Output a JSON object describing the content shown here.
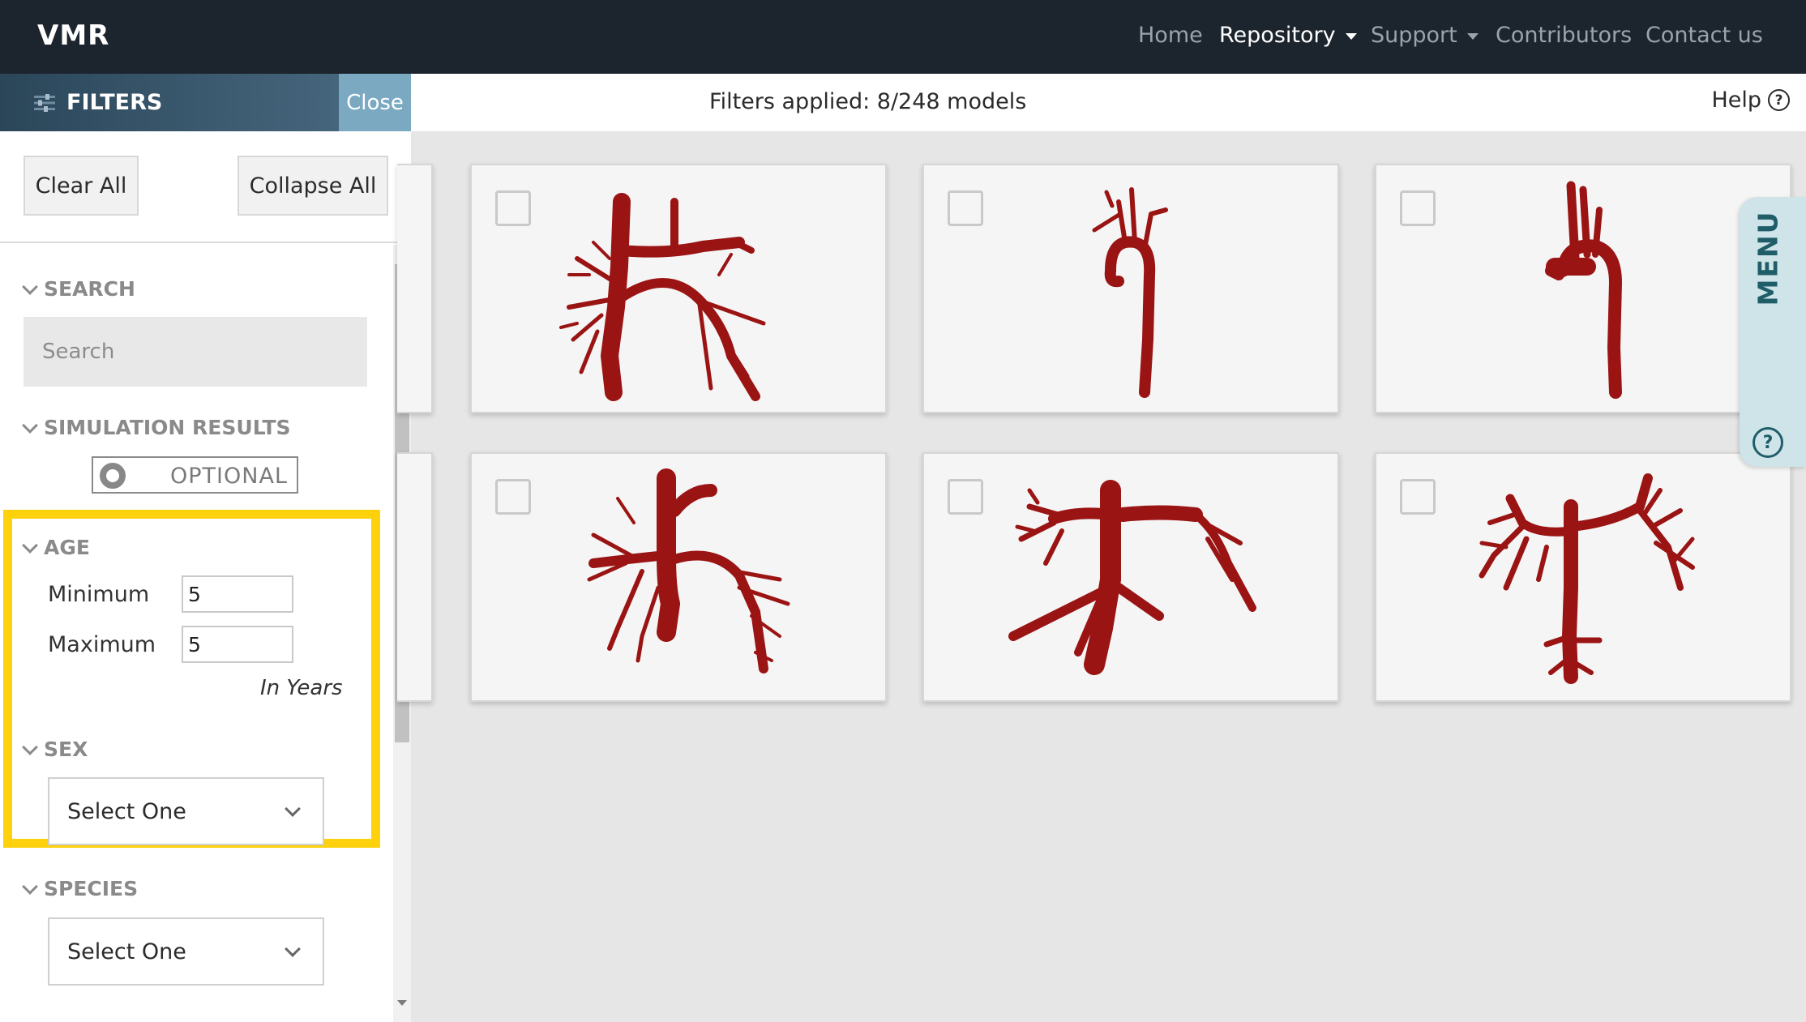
{
  "navbar": {
    "brand": "VMR",
    "items": [
      {
        "label": "Home",
        "active": false,
        "dropdown": false
      },
      {
        "label": "Repository",
        "active": true,
        "dropdown": true
      },
      {
        "label": "Support",
        "active": false,
        "dropdown": true
      },
      {
        "label": "Contributors",
        "active": false,
        "dropdown": false
      },
      {
        "label": "Contact us",
        "active": false,
        "dropdown": false
      }
    ]
  },
  "filters": {
    "title": "FILTERS",
    "close_label": "Close",
    "clear_all_label": "Clear All",
    "collapse_all_label": "Collapse All",
    "search": {
      "heading": "SEARCH",
      "placeholder": "Search",
      "value": ""
    },
    "simulation_results": {
      "heading": "SIMULATION RESULTS",
      "toggle_label": "OPTIONAL"
    },
    "age": {
      "heading": "AGE",
      "min_label": "Minimum",
      "min_value": "5",
      "max_label": "Maximum",
      "max_value": "5",
      "unit": "In Years",
      "highlight_color": "#fdd10c"
    },
    "sex": {
      "heading": "SEX",
      "selected": "Select One"
    },
    "species": {
      "heading": "SPECIES",
      "selected": "Select One"
    }
  },
  "status": {
    "text": "Filters applied: 8/248 models",
    "help_label": "Help",
    "help_icon": "question-circle-icon"
  },
  "menu_tab": {
    "label": "MENU",
    "help_icon": "question-circle-icon"
  },
  "models": {
    "count_visible": 6,
    "vessel_color": "#9b1414",
    "cards": [
      {
        "kind": "pulmonary-tree"
      },
      {
        "kind": "aorta-thin"
      },
      {
        "kind": "aorta-thick"
      },
      {
        "kind": "pulmonary-tree"
      },
      {
        "kind": "pulmonary-wide"
      },
      {
        "kind": "pulmonary-dense"
      }
    ]
  },
  "colors": {
    "navbar_bg": "#1c252e",
    "filter_header": "#2b4659",
    "close_bg": "#7ba9c2",
    "menu_tab_bg": "#cfe4e8",
    "menu_text": "#1f5d69"
  }
}
